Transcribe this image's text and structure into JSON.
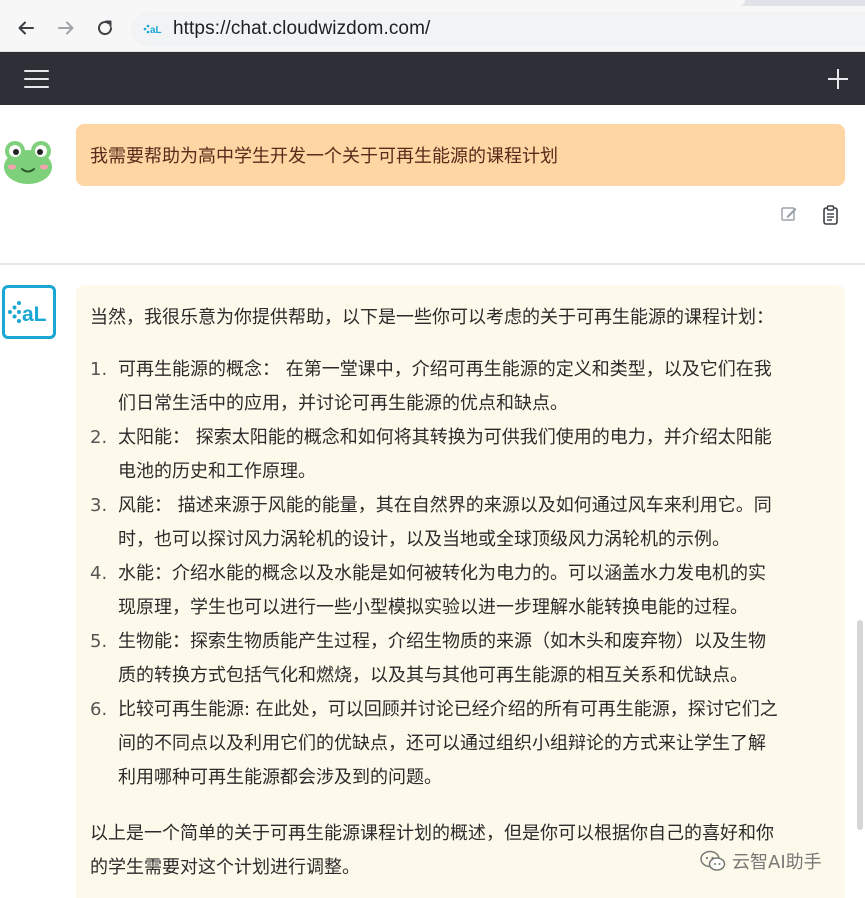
{
  "browser": {
    "url": "https://chat.cloudwizdom.com/",
    "back_icon": "arrow-left-icon",
    "forward_icon": "arrow-right-icon",
    "reload_icon": "reload-icon"
  },
  "header": {
    "menu_icon": "hamburger-icon",
    "new_chat_icon": "plus-icon"
  },
  "user_message": {
    "text": "我需要帮助为高中学生开发一个关于可再生能源的课程计划",
    "bubble_color": "#fdd6a4"
  },
  "assistant_message": {
    "intro": "当然，我很乐意为你提供帮助，以下是一些你可以考虑的关于可再生能源的课程计划：",
    "items": [
      {
        "num": "1.",
        "lines": [
          "可再生能源的概念：  在第一堂课中，介绍可再生能源的定义和类型，以及它们在我",
          "们日常生活中的应用，并讨论可再生能源的优点和缺点。"
        ]
      },
      {
        "num": "2.",
        "lines": [
          "太阳能：  探索太阳能的概念和如何将其转换为可供我们使用的电力，并介绍太阳能",
          "电池的历史和工作原理。"
        ]
      },
      {
        "num": "3.",
        "lines": [
          "风能：  描述来源于风能的能量，其在自然界的来源以及如何通过风车来利用它。同",
          "时，也可以探讨风力涡轮机的设计，以及当地或全球顶级风力涡轮机的示例。"
        ]
      },
      {
        "num": "4.",
        "lines": [
          "水能：介绍水能的概念以及水能是如何被转化为电力的。可以涵盖水力发电机的实",
          "现原理，学生也可以进行一些小型模拟实验以进一步理解水能转换电能的过程。"
        ]
      },
      {
        "num": "5.",
        "lines": [
          "生物能：探索生物质能产生过程，介绍生物质的来源（如木头和废弃物）以及生物",
          "质的转换方式包括气化和燃烧，以及其与其他可再生能源的相互关系和优缺点。"
        ]
      },
      {
        "num": "6.",
        "lines": [
          "比较可再生能源: 在此处，可以回顾并讨论已经介绍的所有可再生能源，探讨它们之",
          "间的不同点以及利用它们的优缺点，还可以通过组织小组辩论的方式来让学生了解",
          "利用哪种可再生能源都会涉及到的问题。"
        ]
      }
    ],
    "summary": [
      "以上是一个简单的关于可再生能源课程计划的概述，但是你可以根据你自己的喜好和你",
      "的学生需要对这个计划进行调整。"
    ],
    "bubble_color": "#fefaeb"
  },
  "watermark": {
    "text": "云智AI助手",
    "icon": "wechat-icon"
  }
}
